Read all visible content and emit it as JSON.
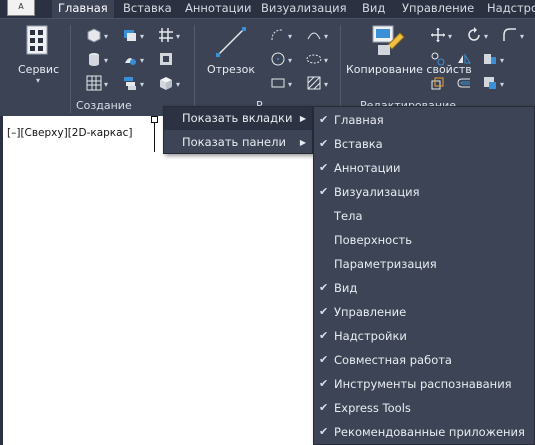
{
  "app": {
    "logo_text": "A"
  },
  "tabs": [
    {
      "label": "Главная",
      "active": true
    },
    {
      "label": "Вставка",
      "active": false
    },
    {
      "label": "Аннотации",
      "active": false
    },
    {
      "label": "Визуализация",
      "active": false
    },
    {
      "label": "Вид",
      "active": false
    },
    {
      "label": "Управление",
      "active": false
    },
    {
      "label": "Надстро",
      "active": false
    }
  ],
  "ribbon": {
    "service_label": "Сервис",
    "create_panel_label": "Создание",
    "line_label": "Отрезок",
    "draw_panel_label_partial": "Р",
    "copy_props_label": "Копирование свойств",
    "edit_panel_label_partial": "Редактирование"
  },
  "viewport": {
    "label": "[–][Сверху][2D-каркас]"
  },
  "menu": {
    "items": [
      {
        "label": "Показать вкладки",
        "highlighted": true
      },
      {
        "label": "Показать панели",
        "highlighted": false
      }
    ],
    "submenu": [
      {
        "label": "Главная",
        "checked": true
      },
      {
        "label": "Вставка",
        "checked": true
      },
      {
        "label": "Аннотации",
        "checked": true
      },
      {
        "label": "Визуализация",
        "checked": true
      },
      {
        "label": "Тела",
        "checked": false
      },
      {
        "label": "Поверхность",
        "checked": false
      },
      {
        "label": "Параметризация",
        "checked": false
      },
      {
        "label": "Вид",
        "checked": true
      },
      {
        "label": "Управление",
        "checked": true
      },
      {
        "label": "Надстройки",
        "checked": true
      },
      {
        "label": "Совместная работа",
        "checked": true
      },
      {
        "label": "Инструменты распознавания",
        "checked": true
      },
      {
        "label": "Express Tools",
        "checked": true
      },
      {
        "label": "Рекомендованные приложения",
        "checked": true
      }
    ],
    "check_glyph": "✔",
    "arrow_glyph": "▶"
  },
  "colors": {
    "ribbon_bg": "#3b4354",
    "tabbar_bg": "#2b3140",
    "menu_bg": "#3d4455",
    "menu_highlight": "#2c3241",
    "canvas_bg": "#ffffff"
  }
}
